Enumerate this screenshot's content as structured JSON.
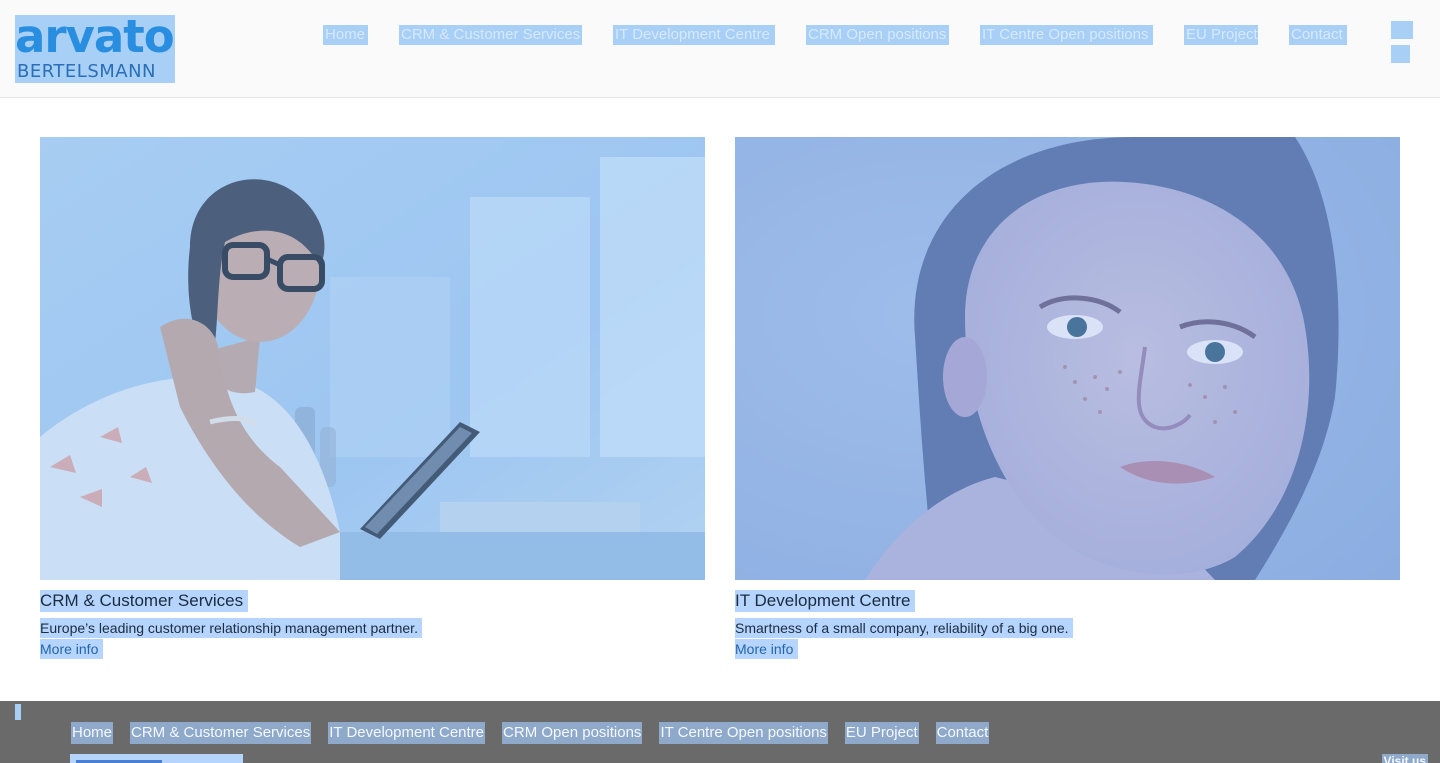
{
  "logo": {
    "word": "arvato",
    "sub": "BERTELSMANN"
  },
  "topnav": {
    "items": [
      {
        "label": "Home"
      },
      {
        "label": "CRM & Customer Services"
      },
      {
        "label": "IT Development Centre"
      },
      {
        "label": "CRM Open positions"
      },
      {
        "label": "IT Centre Open positions"
      },
      {
        "label": "EU Project"
      },
      {
        "label": "Contact"
      }
    ]
  },
  "cards": [
    {
      "title": "CRM & Customer Services",
      "description": "Europe’s leading customer relationship management partner.",
      "link": "More info"
    },
    {
      "title": "IT Development Centre",
      "description": "Smartness of a small company, reliability of a big one.",
      "link": "More info"
    }
  ],
  "footer": {
    "items": [
      {
        "label": "Home"
      },
      {
        "label": "CRM & Customer Services"
      },
      {
        "label": "IT Development Centre"
      },
      {
        "label": "CRM Open positions"
      },
      {
        "label": "IT Centre Open positions"
      },
      {
        "label": "EU Project"
      },
      {
        "label": "Contact"
      }
    ],
    "visit_label": "Visit us"
  },
  "colors": {
    "selection_highlight": "#b5d5ff",
    "brand_blue": "#2a8ee0",
    "footer_bg": "#6a6a6a"
  }
}
